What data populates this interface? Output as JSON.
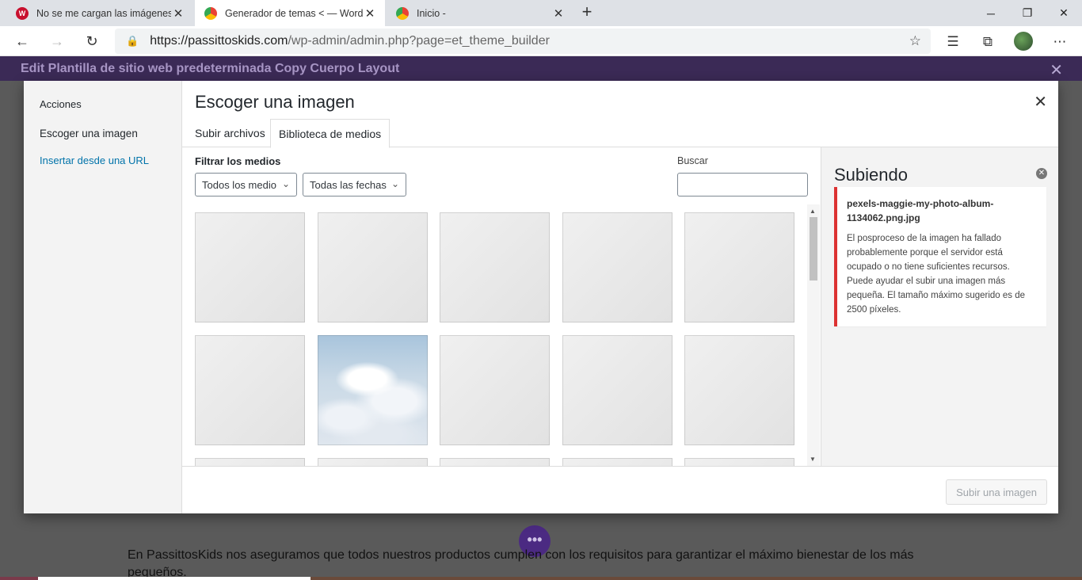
{
  "browser": {
    "tabs": [
      {
        "title": "No se me cargan las imágenes -",
        "favicon": "W"
      },
      {
        "title": "Generador de temas < — WordP",
        "favicon": ""
      },
      {
        "title": "Inicio -",
        "favicon": ""
      }
    ],
    "url_host": "https://passittoskids.com",
    "url_path": "/wp-admin/admin.php?page=et_theme_builder"
  },
  "builder": {
    "title": "Edit Plantilla de sitio web predeterminada Copy Cuerpo Layout"
  },
  "modal": {
    "menu": {
      "actions": "Acciones",
      "choose_image": "Escoger una imagen",
      "insert_url": "Insertar desde una URL"
    },
    "title": "Escoger una imagen",
    "tabs": {
      "upload": "Subir archivos",
      "library": "Biblioteca de medios"
    },
    "filter_label": "Filtrar los medios",
    "filter_type": "Todos los medio",
    "filter_date": "Todas las fechas",
    "search_label": "Buscar",
    "uploading": {
      "heading": "Subiendo",
      "filename": "pexels-maggie-my-photo-album-1134062.png.jpg",
      "message": "El posproceso de la imagen ha fallado probablemente porque el servidor está ocupado o no tiene suficientes recursos. Puede ayudar el subir una imagen más pequeña. El tamaño máximo sugerido es de 2500 píxeles."
    },
    "upload_button": "Subir una imagen"
  },
  "background": {
    "text": "En PassittosKids nos aseguramos que todos nuestros productos cumplen con los requisitos para garantizar el máximo bienestar de los más pequeños."
  },
  "colors": {
    "builder_bar": "#3b2a56",
    "error_border": "#dc3232",
    "link": "#0073aa"
  }
}
